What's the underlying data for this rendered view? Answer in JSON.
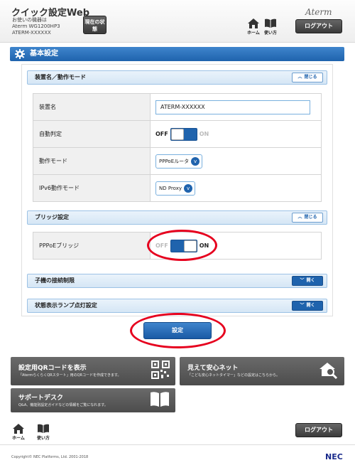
{
  "header": {
    "app_title": "クイック設定Web",
    "device_line1": "お使いの機器は",
    "device_line2": "Aterm WG1200HP3",
    "device_line3": "ATERM-XXXXXX",
    "status_button": "現在の状態",
    "brand": "Aterm",
    "home_label": "ホーム",
    "manual_label": "使い方",
    "logout_label": "ログアウト"
  },
  "main": {
    "section_title": "基本設定",
    "panels": {
      "device": {
        "title": "装置名／動作モード",
        "toggle": "閉じる"
      },
      "bridge": {
        "title": "ブリッジ設定",
        "toggle": "閉じる"
      },
      "child": {
        "title": "子機の接続制限",
        "toggle": "開く"
      },
      "lamp": {
        "title": "状態表示ランプ点灯設定",
        "toggle": "開く"
      }
    },
    "rows": {
      "device_name": {
        "label": "装置名",
        "value": "ATERM-XXXXXX"
      },
      "auto_detect": {
        "label": "自動判定",
        "off": "OFF",
        "on": "ON",
        "state": "off"
      },
      "mode": {
        "label": "動作モード",
        "value": "PPPoEルータ"
      },
      "ipv6": {
        "label": "IPv6動作モード",
        "value": "ND Proxy"
      },
      "pppoe_bridge": {
        "label": "PPPoEブリッジ",
        "off": "OFF",
        "on": "ON",
        "state": "on"
      }
    },
    "submit_label": "設定"
  },
  "tiles": {
    "qr": {
      "title": "設定用QRコードを表示",
      "sub": "「AtermらくらくQRスタート」用のQRコードを作成できます。"
    },
    "safety": {
      "title": "見えて安心ネット",
      "sub": "「こども安心ネットタイマー」などの設定はこちらから。"
    },
    "support": {
      "title": "サポートデスク",
      "sub": "Q&A、機能別設定ガイドなどの情報をご覧になれます。"
    }
  },
  "footer": {
    "home_label": "ホーム",
    "manual_label": "使い方",
    "logout_label": "ログアウト",
    "copyright": "Copyright© NEC Platforms, Ltd. 2001-2018",
    "nec": "NEC"
  },
  "colors": {
    "accent": "#1f63ad",
    "annotation": "#e6001e",
    "panel_bg": "#d5e6f5",
    "tile_bg": "#5a5a5a"
  },
  "icons": [
    "home-icon",
    "book-icon",
    "gear-icon",
    "qr-code-icon",
    "house-search-icon",
    "chevron-up-icon",
    "chevron-down-icon"
  ]
}
